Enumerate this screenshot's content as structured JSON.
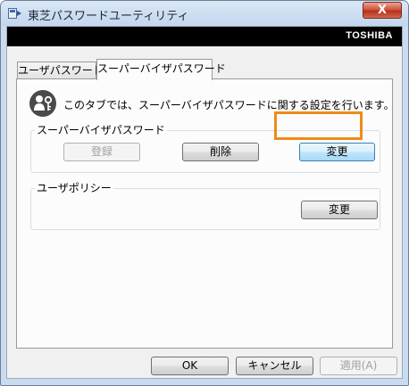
{
  "window": {
    "title": "東芝パスワードユーティリティ",
    "close_label": "X",
    "app_icon": "window-app-icon"
  },
  "brand": {
    "text": "TOSHIBA"
  },
  "tabs": [
    {
      "label": "ユーザパスワード",
      "selected": false
    },
    {
      "label": "スーパーバイザパスワード",
      "selected": true
    }
  ],
  "panel": {
    "icon": "password-info-icon",
    "description": "このタブでは、スーパーバイザパスワードに関する設定を行います。",
    "supervisor_group": {
      "label": "スーパーバイザパスワード",
      "register_button": "登録",
      "delete_button": "削除",
      "change_button": "変更"
    },
    "policy_group": {
      "label": "ユーザポリシー",
      "change_button": "変更"
    }
  },
  "footer": {
    "ok": "OK",
    "cancel": "キャンセル",
    "apply": "適用(A)"
  },
  "colors": {
    "highlight": "#ef8a1a",
    "brand_bar": "#000000"
  }
}
